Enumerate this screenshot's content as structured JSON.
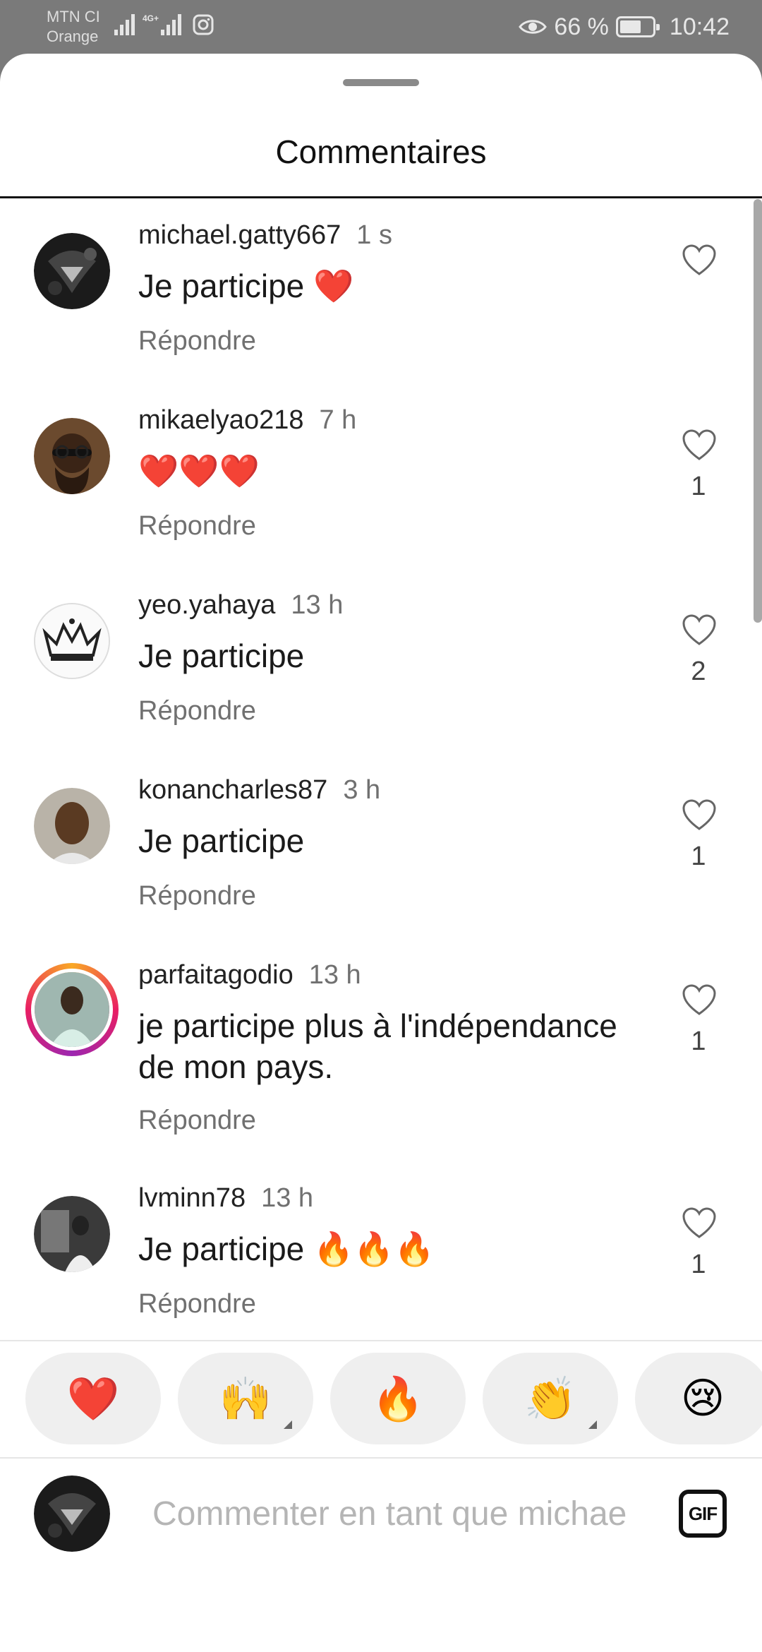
{
  "status_bar": {
    "carrier_1": "MTN CI",
    "carrier_2": "Orange",
    "network": "4G+",
    "battery_percent": "66 %",
    "battery_level": 0.66,
    "time": "10:42",
    "icons": [
      "signal-icon",
      "signal-4g-icon",
      "instagram-icon",
      "eye-icon",
      "battery-icon"
    ]
  },
  "sheet": {
    "title": "Commentaires"
  },
  "comments": [
    {
      "username": "michael.gatty667",
      "time": "1 s",
      "text": "Je participe ❤️",
      "reply": "Répondre",
      "likes": ""
    },
    {
      "username": "mikaelyao218",
      "time": "7 h",
      "text": "❤️❤️❤️",
      "reply": "Répondre",
      "likes": "1"
    },
    {
      "username": "yeo.yahaya",
      "time": "13 h",
      "text": "Je participe",
      "reply": "Répondre",
      "likes": "2"
    },
    {
      "username": "konancharles87",
      "time": "3 h",
      "text": "Je participe",
      "reply": "Répondre",
      "likes": "1"
    },
    {
      "username": "parfaitagodio",
      "time": "13 h",
      "text": "je participe plus à l'indépendance de mon pays.",
      "reply": "Répondre",
      "likes": "1"
    },
    {
      "username": "lvminn78",
      "time": "13 h",
      "text": "Je participe 🔥🔥🔥",
      "reply": "Répondre",
      "likes": "1"
    }
  ],
  "reactions": [
    "❤️",
    "🙌",
    "🔥",
    "👏",
    "😢"
  ],
  "composer": {
    "placeholder": "Commenter en tant que michae",
    "gif_label": "GIF"
  },
  "colors": {
    "status_bg": "#7a7a7a",
    "sheet_bg": "#ffffff",
    "muted_text": "#707070",
    "reaction_bg": "#efefef"
  }
}
